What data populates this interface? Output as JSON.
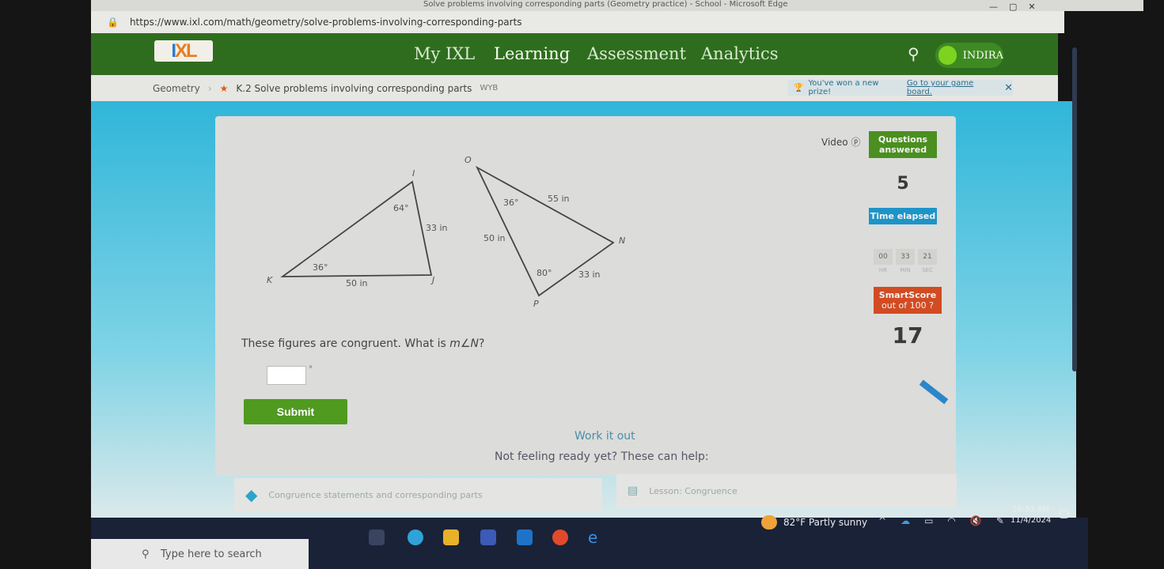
{
  "browser": {
    "window_title": "Solve problems involving corresponding parts (Geometry practice) - School - Microsoft Edge",
    "url": "https://www.ixl.com/math/geometry/solve-problems-involving-corresponding-parts"
  },
  "nav": {
    "logo": "IXL",
    "items": [
      "My IXL",
      "Learning",
      "Assessment",
      "Analytics"
    ],
    "active": "Learning",
    "user": "INDIRA"
  },
  "breadcrumb": {
    "subject": "Geometry",
    "skill": "K.2 Solve problems involving corresponding parts",
    "code": "WYB"
  },
  "prize": {
    "text": "You've won a new prize!",
    "link": "Go to your game board."
  },
  "sidebar": {
    "video": "Video",
    "questions_label": "Questions answered",
    "questions": "5",
    "time_label": "Time elapsed",
    "time": {
      "hr": "00",
      "min": "33",
      "sec": "21"
    },
    "time_units": {
      "hr": "HR",
      "min": "MIN",
      "sec": "SEC"
    },
    "smartscore_label": "SmartScore",
    "smartscore_sub": "out of 100",
    "smartscore": "17"
  },
  "figure": {
    "tri1": {
      "vertices": [
        "I",
        "K",
        "J"
      ],
      "labels": {
        "angle_I": "64°",
        "angle_K": "36°",
        "side_IJ": "33 in",
        "side_KJ": "50 in"
      }
    },
    "tri2": {
      "vertices": [
        "O",
        "N",
        "P"
      ],
      "labels": {
        "angle_O": "36°",
        "angle_P": "80°",
        "side_ON": "55 in",
        "side_OP": "50 in",
        "side_NP": "33 in"
      }
    }
  },
  "question": {
    "text": "These figures are congruent. What is ",
    "math": "m∠N",
    "end": "?",
    "unit": "°",
    "answer": ""
  },
  "submit": "Submit",
  "work_it_out": "Work it out",
  "help_prompt": "Not feeling ready yet? These can help:",
  "resources": [
    "Congruence statements and corresponding parts",
    "Lesson: Congruence"
  ],
  "taskbar": {
    "search_placeholder": "Type here to search",
    "weather": "82°F  Partly sunny",
    "time": "10:53 AM",
    "date": "11/4/2024"
  },
  "colors": {
    "nav_green": "#2f6d1e",
    "questions": "#4a8f1f",
    "time": "#1d94c8",
    "smartscore": "#d24b22",
    "submit": "#4f9a1f"
  }
}
